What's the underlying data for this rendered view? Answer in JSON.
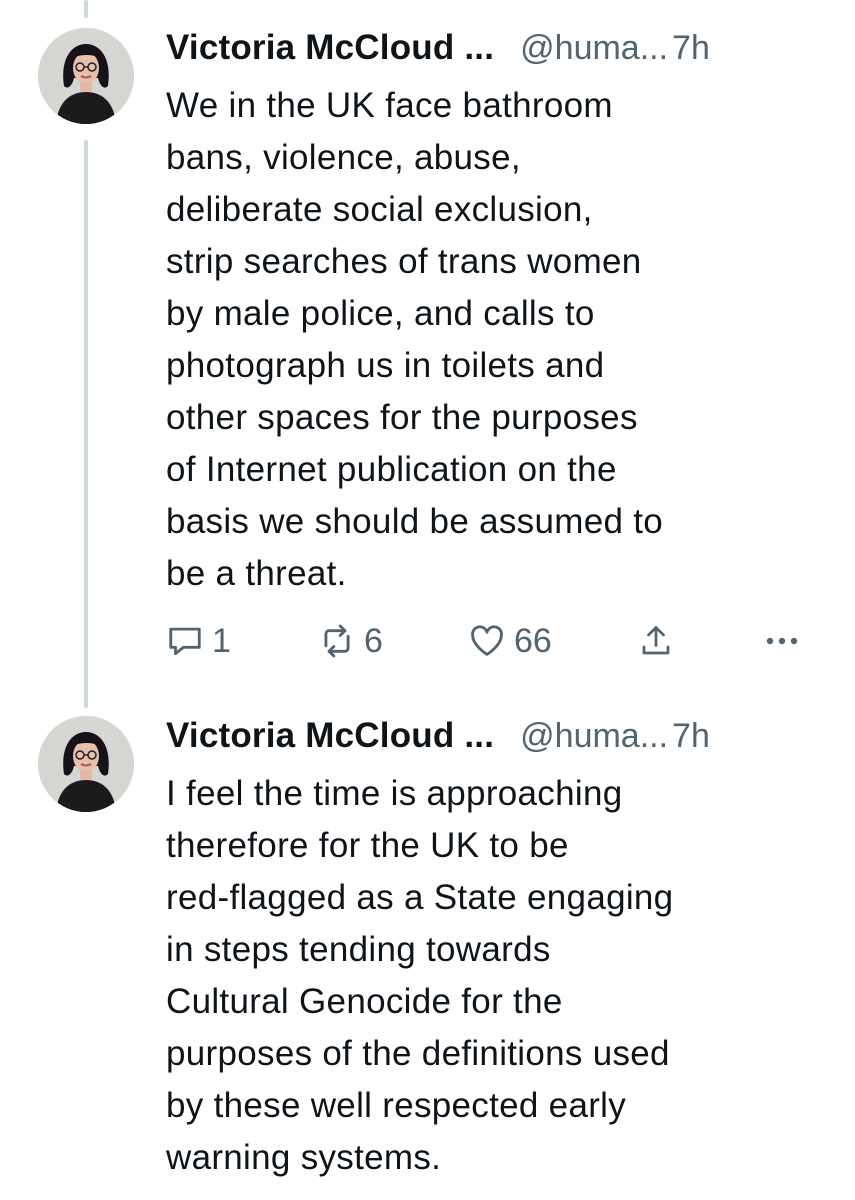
{
  "tweets": [
    {
      "author_name": "Victoria McCloud ...",
      "handle": "@huma...",
      "time": "7h",
      "text": "We in the UK face bathroom\nbans, violence, abuse,\ndeliberate social exclusion,\nstrip searches of trans women\nby male police, and calls to\nphotograph us in toilets and\nother spaces for the purposes\nof Internet publication on the\nbasis we should be assumed to\nbe a threat.",
      "replies": "1",
      "reposts": "6",
      "likes": "66"
    },
    {
      "author_name": "Victoria McCloud ...",
      "handle": "@huma...",
      "time": "7h",
      "text": "I feel the time is approaching\ntherefore for the UK to be\nred-flagged as a State engaging\nin steps tending towards\nCultural Genocide for the\npurposes of the definitions used\nby these well respected early\nwarning systems."
    }
  ],
  "icons": {
    "reply": "reply-icon",
    "repost": "repost-icon",
    "like": "heart-icon",
    "share": "share-icon",
    "more": "more-icon"
  },
  "colors": {
    "text": "#0f1419",
    "secondary": "#536471",
    "thread_line": "#cfd9de",
    "avatar_bg": "#d9d9d6"
  }
}
